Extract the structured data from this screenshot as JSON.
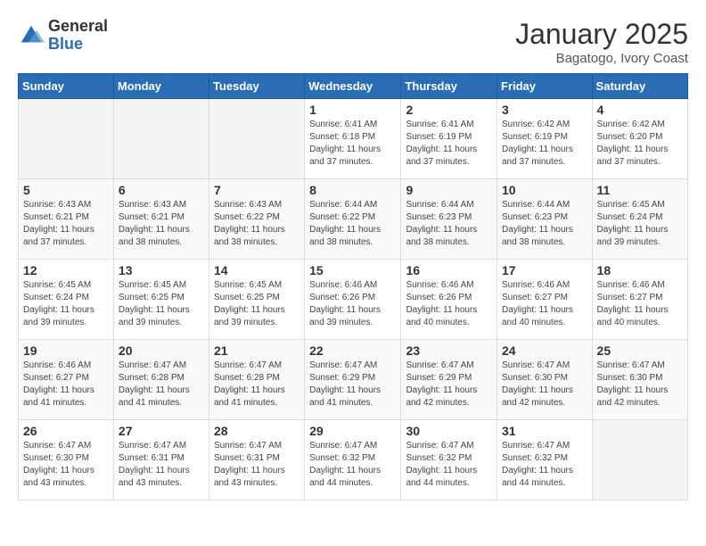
{
  "header": {
    "logo_general": "General",
    "logo_blue": "Blue",
    "month": "January 2025",
    "location": "Bagatogo, Ivory Coast"
  },
  "days_of_week": [
    "Sunday",
    "Monday",
    "Tuesday",
    "Wednesday",
    "Thursday",
    "Friday",
    "Saturday"
  ],
  "weeks": [
    [
      {
        "day": "",
        "info": ""
      },
      {
        "day": "",
        "info": ""
      },
      {
        "day": "",
        "info": ""
      },
      {
        "day": "1",
        "info": "Sunrise: 6:41 AM\nSunset: 6:18 PM\nDaylight: 11 hours and 37 minutes."
      },
      {
        "day": "2",
        "info": "Sunrise: 6:41 AM\nSunset: 6:19 PM\nDaylight: 11 hours and 37 minutes."
      },
      {
        "day": "3",
        "info": "Sunrise: 6:42 AM\nSunset: 6:19 PM\nDaylight: 11 hours and 37 minutes."
      },
      {
        "day": "4",
        "info": "Sunrise: 6:42 AM\nSunset: 6:20 PM\nDaylight: 11 hours and 37 minutes."
      }
    ],
    [
      {
        "day": "5",
        "info": "Sunrise: 6:43 AM\nSunset: 6:21 PM\nDaylight: 11 hours and 37 minutes."
      },
      {
        "day": "6",
        "info": "Sunrise: 6:43 AM\nSunset: 6:21 PM\nDaylight: 11 hours and 38 minutes."
      },
      {
        "day": "7",
        "info": "Sunrise: 6:43 AM\nSunset: 6:22 PM\nDaylight: 11 hours and 38 minutes."
      },
      {
        "day": "8",
        "info": "Sunrise: 6:44 AM\nSunset: 6:22 PM\nDaylight: 11 hours and 38 minutes."
      },
      {
        "day": "9",
        "info": "Sunrise: 6:44 AM\nSunset: 6:23 PM\nDaylight: 11 hours and 38 minutes."
      },
      {
        "day": "10",
        "info": "Sunrise: 6:44 AM\nSunset: 6:23 PM\nDaylight: 11 hours and 38 minutes."
      },
      {
        "day": "11",
        "info": "Sunrise: 6:45 AM\nSunset: 6:24 PM\nDaylight: 11 hours and 39 minutes."
      }
    ],
    [
      {
        "day": "12",
        "info": "Sunrise: 6:45 AM\nSunset: 6:24 PM\nDaylight: 11 hours and 39 minutes."
      },
      {
        "day": "13",
        "info": "Sunrise: 6:45 AM\nSunset: 6:25 PM\nDaylight: 11 hours and 39 minutes."
      },
      {
        "day": "14",
        "info": "Sunrise: 6:45 AM\nSunset: 6:25 PM\nDaylight: 11 hours and 39 minutes."
      },
      {
        "day": "15",
        "info": "Sunrise: 6:46 AM\nSunset: 6:26 PM\nDaylight: 11 hours and 39 minutes."
      },
      {
        "day": "16",
        "info": "Sunrise: 6:46 AM\nSunset: 6:26 PM\nDaylight: 11 hours and 40 minutes."
      },
      {
        "day": "17",
        "info": "Sunrise: 6:46 AM\nSunset: 6:27 PM\nDaylight: 11 hours and 40 minutes."
      },
      {
        "day": "18",
        "info": "Sunrise: 6:46 AM\nSunset: 6:27 PM\nDaylight: 11 hours and 40 minutes."
      }
    ],
    [
      {
        "day": "19",
        "info": "Sunrise: 6:46 AM\nSunset: 6:27 PM\nDaylight: 11 hours and 41 minutes."
      },
      {
        "day": "20",
        "info": "Sunrise: 6:47 AM\nSunset: 6:28 PM\nDaylight: 11 hours and 41 minutes."
      },
      {
        "day": "21",
        "info": "Sunrise: 6:47 AM\nSunset: 6:28 PM\nDaylight: 11 hours and 41 minutes."
      },
      {
        "day": "22",
        "info": "Sunrise: 6:47 AM\nSunset: 6:29 PM\nDaylight: 11 hours and 41 minutes."
      },
      {
        "day": "23",
        "info": "Sunrise: 6:47 AM\nSunset: 6:29 PM\nDaylight: 11 hours and 42 minutes."
      },
      {
        "day": "24",
        "info": "Sunrise: 6:47 AM\nSunset: 6:30 PM\nDaylight: 11 hours and 42 minutes."
      },
      {
        "day": "25",
        "info": "Sunrise: 6:47 AM\nSunset: 6:30 PM\nDaylight: 11 hours and 42 minutes."
      }
    ],
    [
      {
        "day": "26",
        "info": "Sunrise: 6:47 AM\nSunset: 6:30 PM\nDaylight: 11 hours and 43 minutes."
      },
      {
        "day": "27",
        "info": "Sunrise: 6:47 AM\nSunset: 6:31 PM\nDaylight: 11 hours and 43 minutes."
      },
      {
        "day": "28",
        "info": "Sunrise: 6:47 AM\nSunset: 6:31 PM\nDaylight: 11 hours and 43 minutes."
      },
      {
        "day": "29",
        "info": "Sunrise: 6:47 AM\nSunset: 6:32 PM\nDaylight: 11 hours and 44 minutes."
      },
      {
        "day": "30",
        "info": "Sunrise: 6:47 AM\nSunset: 6:32 PM\nDaylight: 11 hours and 44 minutes."
      },
      {
        "day": "31",
        "info": "Sunrise: 6:47 AM\nSunset: 6:32 PM\nDaylight: 11 hours and 44 minutes."
      },
      {
        "day": "",
        "info": ""
      }
    ]
  ]
}
